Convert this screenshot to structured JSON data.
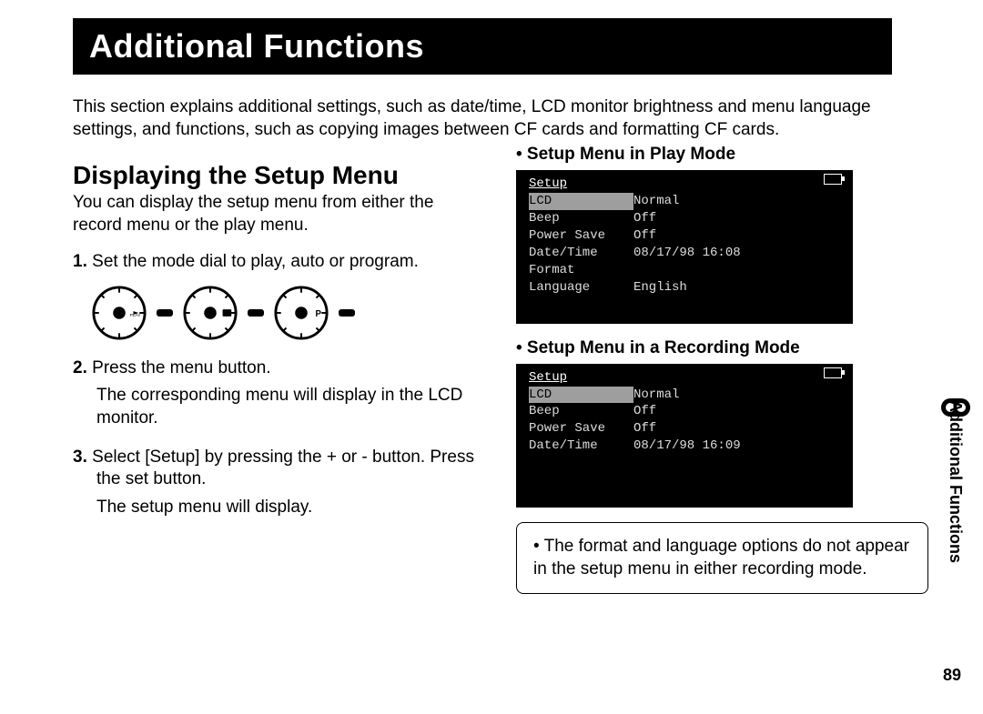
{
  "banner": "Additional Functions",
  "intro": "This section explains additional settings, such as date/time, LCD monitor brightness and menu language settings, and functions, such as copying images between CF cards and formatting CF cards.",
  "h2": "Displaying the Setup Menu",
  "lead": "You can display the setup menu from either the record menu or the play menu.",
  "steps": {
    "s1": {
      "num": "1.",
      "text": "Set the mode dial to play, auto or program."
    },
    "s2": {
      "num": "2.",
      "text": "Press the menu button.",
      "sub": "The corresponding menu will display in the LCD monitor."
    },
    "s3": {
      "num": "3.",
      "text": "Select [Setup] by pressing the + or - button. Press the set button.",
      "sub": "The setup menu will display."
    }
  },
  "right": {
    "playHead": "• Setup Menu in Play Mode",
    "recHead": "• Setup Menu in a Recording Mode"
  },
  "lcd_play": {
    "title": "Setup",
    "rows": [
      {
        "k": "LCD",
        "v": "Normal",
        "sel": true
      },
      {
        "k": "Beep",
        "v": "Off"
      },
      {
        "k": "Power Save",
        "v": "Off"
      },
      {
        "k": "Date/Time",
        "v": "08/17/98 16:08"
      },
      {
        "k": "Format",
        "v": ""
      },
      {
        "k": "Language",
        "v": "English"
      }
    ]
  },
  "lcd_rec": {
    "title": "Setup",
    "rows": [
      {
        "k": "LCD",
        "v": "Normal",
        "sel": true
      },
      {
        "k": "Beep",
        "v": "Off"
      },
      {
        "k": "Power Save",
        "v": "Off"
      },
      {
        "k": "Date/Time",
        "v": "08/17/98 16:09"
      }
    ]
  },
  "note": "• The format and language options do not appear in the setup menu in either recording mode.",
  "sideTab": "Additional Functions",
  "pageNum": "89"
}
